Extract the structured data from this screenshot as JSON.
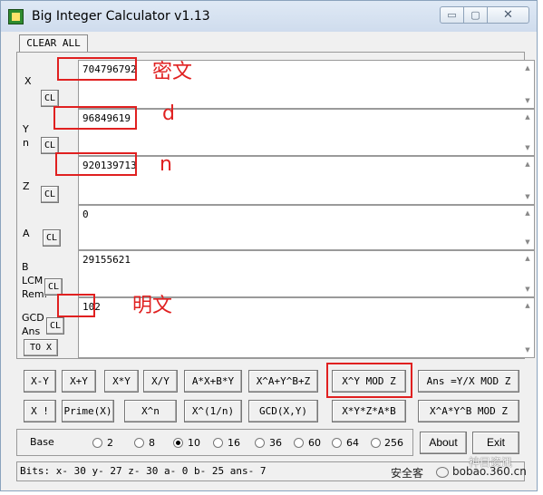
{
  "window": {
    "title": "Big Integer Calculator v1.13",
    "min_glyph": "▭",
    "max_glyph": "▢",
    "close_glyph": "✕"
  },
  "tab": {
    "clear_all": "CLEAR ALL"
  },
  "fields": {
    "x": {
      "label": "X",
      "value": "704796792",
      "cl": "CL"
    },
    "y": {
      "label1": "Y",
      "label2": "n",
      "value": "96849619",
      "cl": "CL"
    },
    "z": {
      "label": "Z",
      "value": "920139713",
      "cl": "CL"
    },
    "a": {
      "label": "A",
      "value": "0",
      "cl": "CL"
    },
    "b": {
      "label1": "B",
      "label2": "LCM",
      "label3": "Rem.",
      "value": "29155621",
      "cl": "CL"
    },
    "gcd": {
      "label1": "GCD",
      "label2": "Ans",
      "value": "102",
      "cl": "CL",
      "to_x": "TO X"
    }
  },
  "annotations": {
    "x_note": "密文",
    "y_note": "d",
    "z_note": "n",
    "ans_note": "明文",
    "box_color": "#e02020"
  },
  "buttons_row1": [
    "X-Y",
    "X+Y",
    "X*Y",
    "X/Y",
    "A*X+B*Y",
    "X^A+Y^B+Z",
    "X^Y MOD Z",
    "Ans =Y/X MOD Z"
  ],
  "buttons_row2": [
    "X !",
    "Prime(X)",
    "X^n",
    "X^(1/n)",
    "GCD(X,Y)",
    "X*Y*Z*A*B",
    "X^A*Y^B MOD Z"
  ],
  "base": {
    "label": "Base",
    "options": [
      "2",
      "8",
      "10",
      "16",
      "36",
      "60",
      "64",
      "256"
    ],
    "selected": "10"
  },
  "about_label": "About",
  "exit_label": "Exit",
  "status": "Bits: x- 30 y- 27 z- 30 a- 0 b- 25 ans- 7",
  "watermark": {
    "left": "安全客",
    "right": "bobao.360.cn",
    "icon": "wechat-icon",
    "overlay": "神目资讯"
  }
}
